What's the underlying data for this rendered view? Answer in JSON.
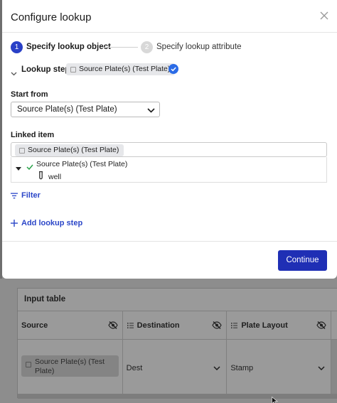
{
  "modal": {
    "title": "Configure lookup",
    "steps": [
      {
        "number": "1",
        "label": "Specify lookup object",
        "state": "active"
      },
      {
        "number": "2",
        "label": "Specify lookup attribute",
        "state": "inactive"
      }
    ],
    "lookup_step": {
      "label": "Lookup step",
      "chip": "Source Plate(s) (Test Plate)"
    },
    "start_from": {
      "label": "Start from",
      "value": "Source Plate(s) (Test Plate)"
    },
    "linked_item": {
      "label": "Linked item",
      "chip": "Source Plate(s) (Test Plate)",
      "tree": [
        {
          "label": "Source Plate(s) (Test Plate)",
          "checked": true
        },
        {
          "label": "well"
        }
      ]
    },
    "filter_label": "Filter",
    "add_step_label": "Add lookup step",
    "continue_label": "Continue"
  },
  "background": {
    "table_title": "Input table",
    "columns": [
      {
        "label": "Source"
      },
      {
        "label": "Destination"
      },
      {
        "label": "Plate Layout"
      }
    ],
    "row": {
      "source": "Source Plate(s) (Test Plate)",
      "destination": "Dest",
      "plate_layout": "Stamp"
    }
  },
  "colors": {
    "accent": "#2940c7",
    "button": "#1f2fb5",
    "check": "#2b6be6",
    "link": "#2b46c8",
    "overlay": "#8b8b8b"
  },
  "icons": [
    "close-icon",
    "chevron-down-icon",
    "check-circle-icon",
    "table-icon",
    "checkmark-icon",
    "test-tube-icon",
    "filter-icon",
    "plus-icon",
    "eye-off-icon",
    "list-icon",
    "cursor-icon"
  ]
}
